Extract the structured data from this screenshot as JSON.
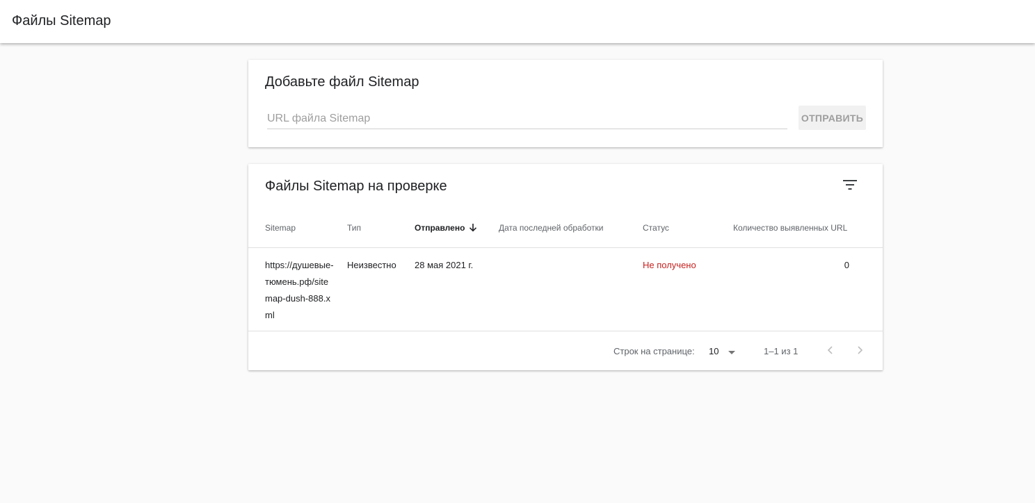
{
  "header": {
    "title": "Файлы Sitemap"
  },
  "add_card": {
    "title": "Добавьте файл Sitemap",
    "input_placeholder": "URL файла Sitemap",
    "input_value": "",
    "submit_label": "ОТПРАВИТЬ"
  },
  "list_card": {
    "title": "Файлы Sitemap на проверке",
    "filter_icon": "filter-list-icon",
    "columns": {
      "sitemap": "Sitemap",
      "type": "Тип",
      "submitted": "Отправлено",
      "last_read": "Дата последней обработки",
      "status": "Статус",
      "urls_found": "Количество выявленных URL"
    },
    "rows": [
      {
        "sitemap": "https://душевые-тюмень.рф/sitemap-dush-888.xml",
        "type": "Неизвестно",
        "submitted": "28 мая 2021 г.",
        "last_read": "",
        "status": "Не получено",
        "urls_found": "0"
      }
    ],
    "pagination": {
      "rows_per_page_label": "Строк на странице:",
      "rows_per_page_value": "10",
      "range": "1–1 из 1"
    }
  },
  "colors": {
    "status_error": "#c5221f",
    "muted": "#5f6368",
    "background": "#fafafa"
  }
}
